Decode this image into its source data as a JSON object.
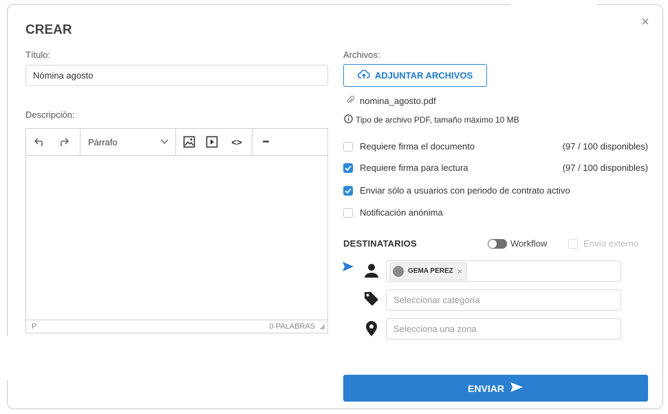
{
  "dialog": {
    "title": "CREAR",
    "close_glyph": "×",
    "title_label": "Título:",
    "title_value": "Nómina agosto",
    "description_label": "Descripción:"
  },
  "editor": {
    "format_select": "Párrafo",
    "more_glyph": "•••",
    "code_glyph": "<>",
    "status_path": "P",
    "word_count": "0 PALABRAS",
    "icons": [
      "undo-icon",
      "redo-icon",
      "chevron-down-icon",
      "image-icon",
      "media-icon",
      "code-icon",
      "more-icon"
    ]
  },
  "files": {
    "label": "Archivos:",
    "attach_button": "ADJUNTAR ARCHIVOS",
    "file_name": "nomina_agosto.pdf",
    "info_text": "Tipo de archivo PDF, tamaño máximo 10 MB"
  },
  "options": [
    {
      "label": "Requiere firma el documento",
      "checked": false,
      "availability": "(97 / 100 disponibles)"
    },
    {
      "label": "Requiere firma para lectura",
      "checked": true,
      "availability": "(97 / 100 disponibles)"
    },
    {
      "label": "Enviar sólo a usuarios con periodo de contrato activo",
      "checked": true,
      "availability": ""
    },
    {
      "label": "Notificación anónima",
      "checked": false,
      "availability": ""
    }
  ],
  "recipients": {
    "title": "DESTINATARIOS",
    "workflow_label": "Workflow",
    "workflow_on": false,
    "external_label": "Envío externo",
    "selected_user": "GEMA PEREZ",
    "chip_remove": "×",
    "category_placeholder": "Seleccionar categoría",
    "zone_placeholder": "Selecciona una zona"
  },
  "submit": {
    "label": "ENVIAR"
  },
  "colors": {
    "primary": "#2a7fd1",
    "checkbox_on": "#2b88d8",
    "border": "#d8d8d8"
  }
}
